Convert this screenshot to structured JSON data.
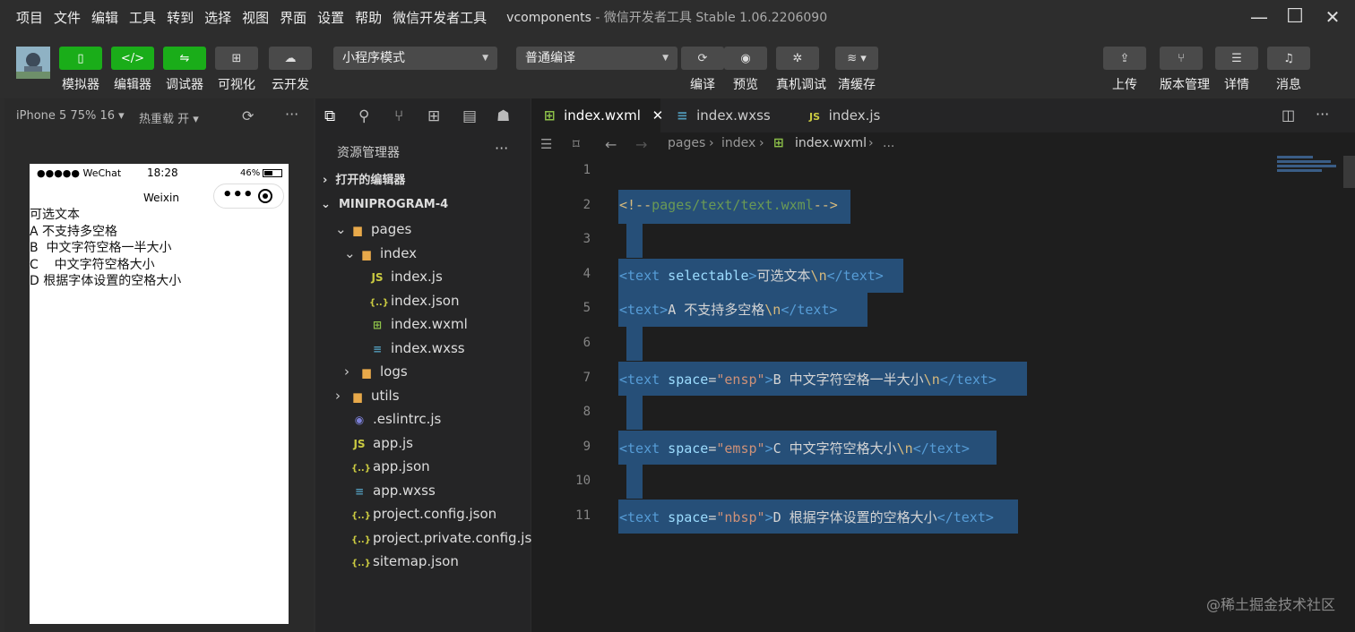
{
  "menu": [
    "项目",
    "文件",
    "编辑",
    "工具",
    "转到",
    "选择",
    "视图",
    "界面",
    "设置",
    "帮助",
    "微信开发者工具"
  ],
  "window": {
    "project": "vcomponents",
    "app_title": "- 微信开发者工具 Stable 1.06.2206090"
  },
  "toolbar": {
    "simulator": "模拟器",
    "editor": "编辑器",
    "debugger": "调试器",
    "visual": "可视化",
    "cloud": "云开发",
    "mode_select": "小程序模式",
    "compile_select": "普通编译",
    "compile": "编译",
    "preview": "预览",
    "device_debug": "真机调试",
    "clear_cache": "清缓存",
    "upload": "上传",
    "version": "版本管理",
    "details": "详情",
    "messages": "消息"
  },
  "simulator": {
    "device": "iPhone 5 75% 16 ▾",
    "hot_reload": "热重载 开 ▾",
    "status_left": "●●●●● WeChat",
    "status_time": "18:28",
    "status_battery": "46%",
    "nav_title": "Weixin",
    "lines": [
      "可选文本",
      "A 不支持多空格",
      "B  中文字符空格一半大小",
      "C    中文字符空格大小",
      "D 根据字体设置的空格大小"
    ]
  },
  "explorer": {
    "title": "资源管理器",
    "open_editors": "打开的编辑器",
    "project": "MINIPROGRAM-4",
    "tree": [
      {
        "name": "pages",
        "icon": "folder"
      },
      {
        "name": "index",
        "icon": "folder"
      },
      {
        "name": "index.js",
        "icon": "js"
      },
      {
        "name": "index.json",
        "icon": "json"
      },
      {
        "name": "index.wxml",
        "icon": "wxml"
      },
      {
        "name": "index.wxss",
        "icon": "wxss"
      },
      {
        "name": "logs",
        "icon": "folder"
      },
      {
        "name": "utils",
        "icon": "folder"
      },
      {
        "name": ".eslintrc.js",
        "icon": "eslint"
      },
      {
        "name": "app.js",
        "icon": "js"
      },
      {
        "name": "app.json",
        "icon": "json"
      },
      {
        "name": "app.wxss",
        "icon": "wxss"
      },
      {
        "name": "project.config.json",
        "icon": "json"
      },
      {
        "name": "project.private.config.js...",
        "icon": "json"
      },
      {
        "name": "sitemap.json",
        "icon": "json"
      }
    ]
  },
  "editor": {
    "tabs": [
      "index.wxml",
      "index.wxss",
      "index.js"
    ],
    "active_tab": "index.wxml",
    "breadcrumb": [
      "pages",
      "index",
      "index.wxml",
      "..."
    ],
    "lines": [
      {
        "n": "1",
        "code": ""
      },
      {
        "n": "2",
        "code": "<!--pages/text/text.wxml-->"
      },
      {
        "n": "3",
        "code": ""
      },
      {
        "n": "4",
        "code": "<text selectable>可选文本\\n</text>"
      },
      {
        "n": "5",
        "code": "<text>A 不支持多空格\\n</text>"
      },
      {
        "n": "6",
        "code": ""
      },
      {
        "n": "7",
        "code": "<text space=\"ensp\">B 中文字符空格一半大小\\n</text>"
      },
      {
        "n": "8",
        "code": ""
      },
      {
        "n": "9",
        "code": "<text space=\"emsp\">C 中文字符空格大小\\n</text>"
      },
      {
        "n": "10",
        "code": ""
      },
      {
        "n": "11",
        "code": "<text space=\"nbsp\">D 根据字体设置的空格大小</text>"
      }
    ]
  },
  "watermark": "@稀土掘金技术社区",
  "colors": {
    "green": "#1aad19",
    "selection": "#264f78",
    "tag": "#569cd6",
    "attr": "#9cdcfe",
    "string": "#ce9178"
  }
}
